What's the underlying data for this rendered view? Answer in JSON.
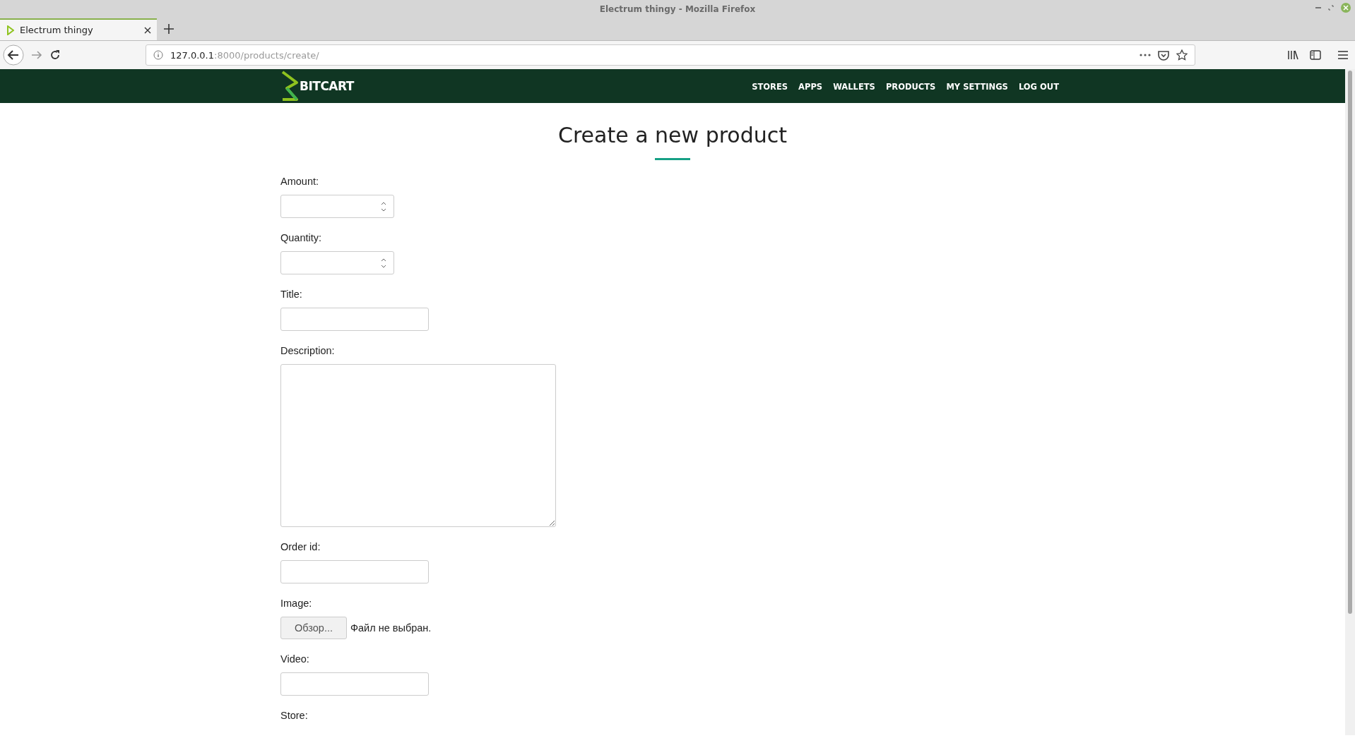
{
  "window": {
    "title": "Electrum thingy - Mozilla Firefox"
  },
  "tabs": [
    {
      "label": "Electrum thingy",
      "selected": true
    }
  ],
  "address": {
    "host": "127.0.0.1",
    "path": ":8000/products/create/"
  },
  "site_nav": {
    "logo": "BITCART",
    "items": [
      {
        "label": "STORES"
      },
      {
        "label": "APPS"
      },
      {
        "label": "WALLETS"
      },
      {
        "label": "PRODUCTS"
      },
      {
        "label": "MY SETTINGS"
      },
      {
        "label": "LOG OUT"
      }
    ]
  },
  "heading": "Create a new product",
  "fields": [
    {
      "label": "Amount:",
      "kind": "number"
    },
    {
      "label": "Quantity:",
      "kind": "number"
    },
    {
      "label": "Title:",
      "kind": "text"
    },
    {
      "label": "Description:",
      "kind": "textarea"
    },
    {
      "label": "Order id:",
      "kind": "text"
    },
    {
      "label": "Image:",
      "kind": "file",
      "button": "Обзор...",
      "status": "Файл не выбран."
    },
    {
      "label": "Video:",
      "kind": "text"
    },
    {
      "label": "Store:",
      "kind": "cut"
    }
  ]
}
